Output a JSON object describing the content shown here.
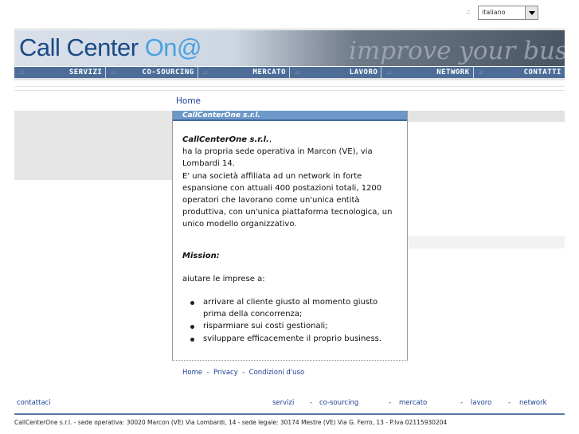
{
  "language": {
    "dots": ".:",
    "selected": "italiano"
  },
  "header": {
    "logo_main": "Call Center ",
    "logo_accent": "On@",
    "tagline": "improve your business"
  },
  "nav": {
    "items": [
      {
        "dots": ".::",
        "label": "SERVIZI"
      },
      {
        "dots": ".::",
        "label": "CO-SOURCING"
      },
      {
        "dots": ".::",
        "label": "MERCATO"
      },
      {
        "dots": ".::",
        "label": "LAVORO"
      },
      {
        "dots": ".::",
        "label": "NETWORK"
      },
      {
        "dots": ".::",
        "label": "CONTATTI"
      }
    ]
  },
  "breadcrumb": "Home",
  "panel": {
    "title": "CallCenterOne s.r.l.",
    "company_name": "CallCenterOne s.r.l.",
    "intro_suffix": ",",
    "para1": "ha la propria sede operativa in Marcon (VE), via Lombardi 14.",
    "para2": "E' una società affiliata ad un network in forte espansione con attuali 400 postazioni totali, 1200 operatori che lavorano come un'unica entità produttiva, con un'unica piattaforma tecnologica, un unico modello organizzativo.",
    "mission_title": "Mission:",
    "mission_intro": "aiutare le imprese a:",
    "mission_items": [
      "arrivare al cliente giusto al momento giusto prima della concorrenza;",
      "risparmiare sui costi gestionali;",
      "sviluppare efficacemente il proprio business."
    ]
  },
  "footer_links": {
    "home": "Home",
    "sep": "  -  ",
    "privacy": "Privacy",
    "conditions": "Condizioni d'uso"
  },
  "bottom": {
    "contact": "contattaci",
    "links": [
      "servizi",
      "co-sourcing",
      "mercato",
      "lavoro",
      "network"
    ],
    "sep": "-"
  },
  "footer_info": "CallCenterOne s.r.l. - sede operativa: 30020 Marcon (VE) Via Lombardi, 14 - sede legale: 30174 Mestre (VE) Via G. Ferro, 13 - P.Iva 02115930204"
}
